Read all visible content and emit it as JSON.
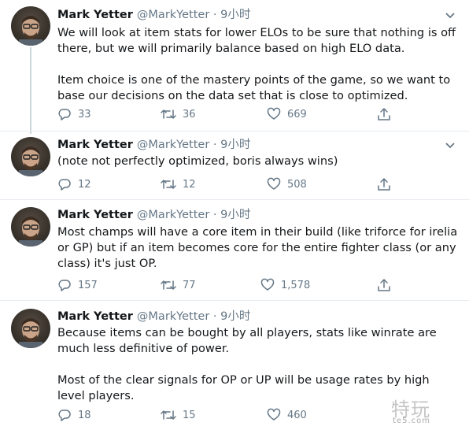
{
  "tweets": [
    {
      "name": "Mark Yetter",
      "handle": "@MarkYetter",
      "separator": "·",
      "time": "9小时",
      "text": "We will look at item stats for lower ELOs to be sure that nothing is off there, but we will primarily balance based on high ELO data.\n\nItem choice is one of the mastery points of the game, so we want to base our decisions on the data set that is close to optimized.",
      "replies": "33",
      "retweets": "36",
      "likes": "669"
    },
    {
      "name": "Mark Yetter",
      "handle": "@MarkYetter",
      "separator": "·",
      "time": "9小时",
      "text": "(note not perfectly optimized, boris always wins)",
      "replies": "12",
      "retweets": "12",
      "likes": "508"
    },
    {
      "name": "Mark Yetter",
      "handle": "@MarkYetter",
      "separator": "·",
      "time": "9小时",
      "text": "Most champs will have a core item in their build (like triforce for irelia or GP) but if an item becomes core for the entire fighter class (or any class) it's just OP.",
      "replies": "157",
      "retweets": "77",
      "likes": "1,578"
    },
    {
      "name": "Mark Yetter",
      "handle": "@MarkYetter",
      "separator": "·",
      "time": "9小时",
      "text": "Because items can be bought by all players, stats like winrate are much less definitive of power.\n\nMost of the clear signals for OP or UP will be usage rates by high level players.",
      "replies": "18",
      "retweets": "15",
      "likes": "460"
    }
  ],
  "watermark": {
    "main": "特玩",
    "sub": "te5.com"
  },
  "colors": {
    "text": "#14171a",
    "muted": "#657786",
    "divider": "#e6ecf0",
    "thread_line": "#ccd6dd"
  },
  "icons": [
    "reply-icon",
    "retweet-icon",
    "like-icon",
    "share-icon",
    "chevron-down-icon"
  ]
}
